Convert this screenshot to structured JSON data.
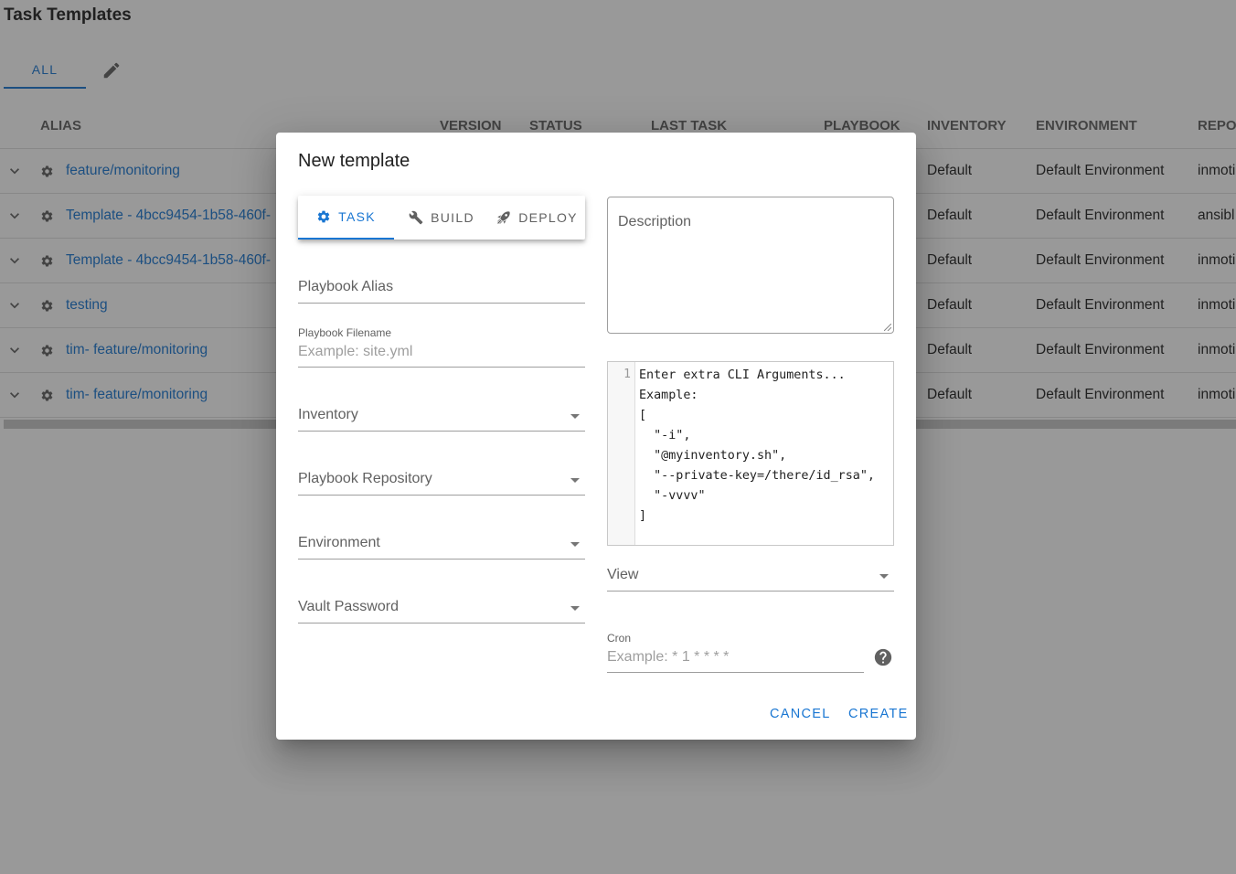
{
  "page": {
    "title": "Task Templates",
    "tabs": {
      "all": "ALL"
    }
  },
  "table": {
    "headers": {
      "alias": "ALIAS",
      "version": "VERSION",
      "status": "STATUS",
      "last_task": "LAST TASK",
      "playbook": "PLAYBOOK",
      "inventory": "INVENTORY",
      "environment": "ENVIRONMENT",
      "repository": "REPOS"
    },
    "rows": [
      {
        "alias": "feature/monitoring",
        "inventory": "Default",
        "environment": "Default Environment",
        "repository": "inmoti"
      },
      {
        "alias": "Template - 4bcc9454-1b58-460f-",
        "inventory": "Default",
        "environment": "Default Environment",
        "repository": "ansibl"
      },
      {
        "alias": "Template - 4bcc9454-1b58-460f-",
        "inventory": "Default",
        "environment": "Default Environment",
        "repository": "inmoti"
      },
      {
        "alias": "testing",
        "inventory": "Default",
        "environment": "Default Environment",
        "repository": "inmoti"
      },
      {
        "alias": "tim- feature/monitoring",
        "inventory": "Default",
        "environment": "Default Environment",
        "repository": "inmoti"
      },
      {
        "alias": "tim- feature/monitoring",
        "inventory": "Default",
        "environment": "Default Environment",
        "repository": "inmoti"
      }
    ]
  },
  "dialog": {
    "title": "New template",
    "tabs": {
      "task": "TASK",
      "build": "BUILD",
      "deploy": "DEPLOY"
    },
    "playbook_alias_label": "Playbook Alias",
    "playbook_filename_label": "Playbook Filename",
    "playbook_filename_placeholder": "Example: site.yml",
    "inventory_label": "Inventory",
    "repository_label": "Playbook Repository",
    "environment_label": "Environment",
    "vault_label": "Vault Password",
    "description_label": "Description",
    "cli_line_number": "1",
    "cli_placeholder": "Enter extra CLI Arguments...\nExample:\n[\n  \"-i\",\n  \"@myinventory.sh\",\n  \"--private-key=/there/id_rsa\",\n  \"-vvvv\"\n]",
    "view_label": "View",
    "cron_label": "Cron",
    "cron_placeholder": "Example: * 1 * * * *",
    "cancel_label": "CANCEL",
    "create_label": "CREATE"
  },
  "colors": {
    "accent": "#1976d2",
    "overlay": "rgba(33,33,33,0.46)"
  }
}
